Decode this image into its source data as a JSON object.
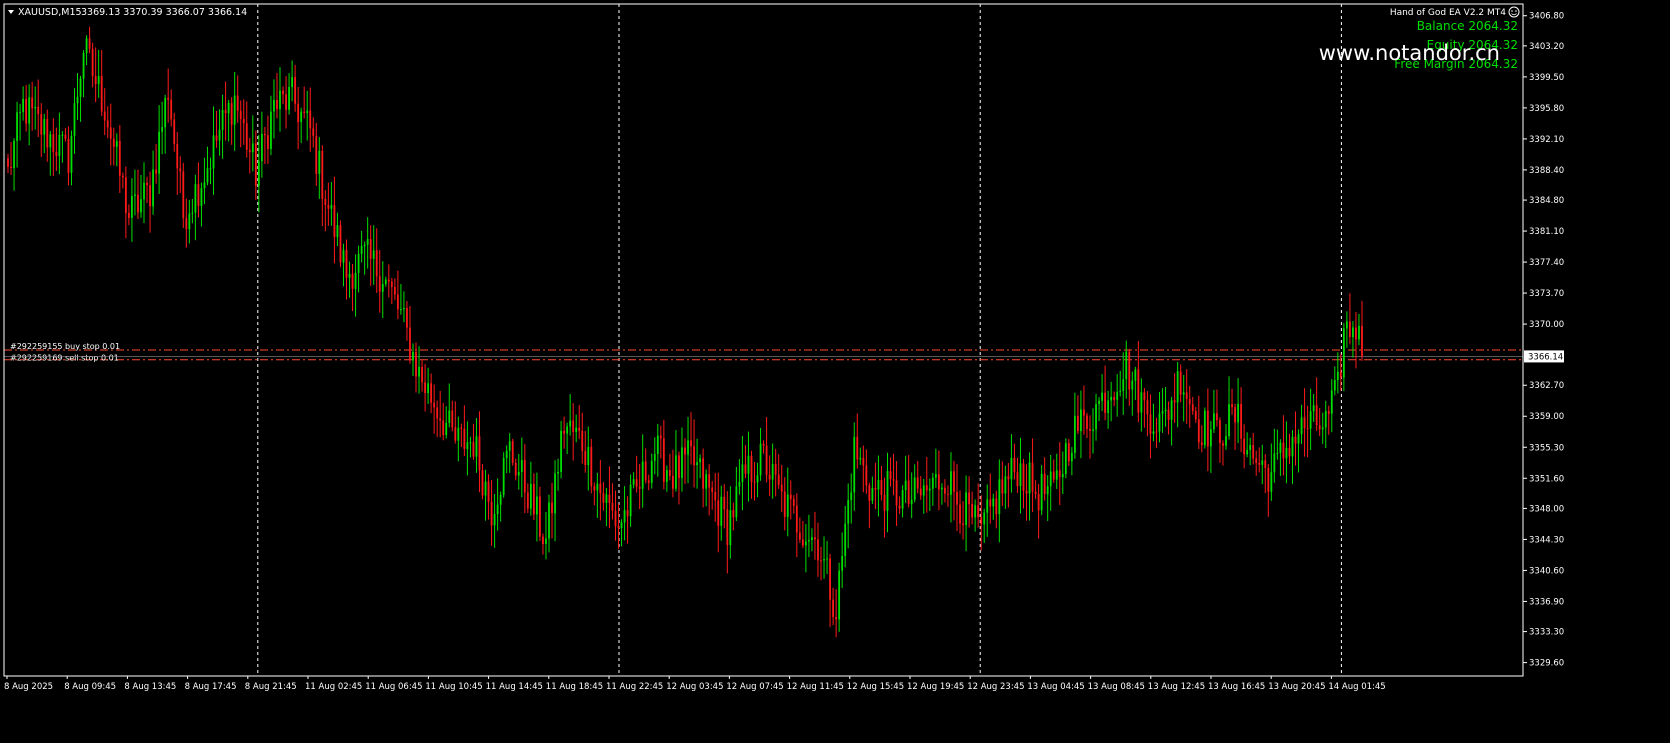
{
  "header": {
    "symbol": "XAUUSD,M15",
    "ohlc": "3369.13 3370.39 3366.07 3366.14"
  },
  "ea_panel": {
    "title": "Hand of God EA  V2.2 MT4",
    "balance": "Balance 2064.32",
    "equity": "Equity 2064.32",
    "free_margin": "Free Margin 2064.32",
    "watermark": "www.notandor.cn"
  },
  "orders": [
    {
      "label": "#292259155 buy stop 0.01",
      "price": 3366.9,
      "color": "#ff4d2e"
    },
    {
      "label": "#292259169 sell stop 0.01",
      "price": 3365.75,
      "color": "#ff4d2e"
    }
  ],
  "price_badge": {
    "value": "3366.14",
    "price": 3366.14
  },
  "colors": {
    "bull": "#00e000",
    "bear": "#ff1a1a",
    "grid": "#ffffff",
    "axis_text": "#ffffff",
    "background": "#000000"
  },
  "chart_data": {
    "type": "candlestick",
    "symbol": "XAUUSD",
    "timeframe": "M15",
    "ylim": [
      3328.0,
      3408.2
    ],
    "y_ticks": [
      "3406.80",
      "3403.20",
      "3399.50",
      "3395.80",
      "3392.10",
      "3388.40",
      "3384.80",
      "3381.10",
      "3377.40",
      "3373.70",
      "3370.00",
      "3366.14",
      "3362.70",
      "3359.00",
      "3355.30",
      "3351.60",
      "3348.00",
      "3344.30",
      "3340.60",
      "3336.90",
      "3333.30",
      "3329.60"
    ],
    "x_ticks": [
      "8 Aug 2025",
      "8 Aug 09:45",
      "8 Aug 13:45",
      "8 Aug 17:45",
      "8 Aug 21:45",
      "11 Aug 02:45",
      "11 Aug 06:45",
      "11 Aug 10:45",
      "11 Aug 14:45",
      "11 Aug 18:45",
      "11 Aug 22:45",
      "12 Aug 03:45",
      "12 Aug 07:45",
      "12 Aug 11:45",
      "12 Aug 15:45",
      "12 Aug 19:45",
      "12 Aug 23:45",
      "13 Aug 04:45",
      "13 Aug 08:45",
      "13 Aug 12:45",
      "13 Aug 16:45",
      "13 Aug 20:45",
      "14 Aug 01:45"
    ],
    "grid": "vertical dashed separators",
    "anchors": [
      [
        0,
        3388
      ],
      [
        5,
        3396
      ],
      [
        12,
        3393
      ],
      [
        20,
        3390
      ],
      [
        25,
        3403
      ],
      [
        32,
        3396
      ],
      [
        40,
        3383
      ],
      [
        47,
        3386
      ],
      [
        53,
        3398
      ],
      [
        58,
        3383
      ],
      [
        65,
        3388
      ],
      [
        70,
        3393
      ],
      [
        75,
        3397
      ],
      [
        82,
        3388
      ],
      [
        88,
        3396
      ],
      [
        94,
        3397
      ],
      [
        100,
        3393
      ],
      [
        106,
        3384
      ],
      [
        112,
        3376
      ],
      [
        118,
        3378
      ],
      [
        124,
        3376
      ],
      [
        130,
        3371
      ],
      [
        136,
        3364
      ],
      [
        142,
        3360
      ],
      [
        148,
        3356
      ],
      [
        154,
        3356
      ],
      [
        160,
        3348
      ],
      [
        166,
        3355
      ],
      [
        172,
        3350
      ],
      [
        178,
        3344
      ],
      [
        184,
        3358
      ],
      [
        190,
        3356
      ],
      [
        196,
        3350
      ],
      [
        202,
        3346
      ],
      [
        208,
        3350
      ],
      [
        214,
        3355
      ],
      [
        220,
        3352
      ],
      [
        226,
        3354
      ],
      [
        232,
        3350
      ],
      [
        238,
        3346
      ],
      [
        244,
        3352
      ],
      [
        250,
        3354
      ],
      [
        256,
        3349
      ],
      [
        262,
        3346
      ],
      [
        268,
        3344
      ],
      [
        274,
        3336
      ],
      [
        280,
        3355
      ],
      [
        286,
        3350
      ],
      [
        292,
        3350
      ],
      [
        298,
        3349
      ],
      [
        304,
        3350
      ],
      [
        310,
        3352
      ],
      [
        316,
        3348
      ],
      [
        322,
        3345
      ],
      [
        328,
        3350
      ],
      [
        334,
        3353
      ],
      [
        340,
        3350
      ],
      [
        346,
        3350
      ],
      [
        352,
        3357
      ],
      [
        358,
        3359
      ],
      [
        364,
        3362
      ],
      [
        370,
        3365
      ],
      [
        376,
        3360
      ],
      [
        382,
        3358
      ],
      [
        388,
        3364
      ],
      [
        394,
        3358
      ],
      [
        400,
        3357
      ],
      [
        406,
        3359
      ],
      [
        412,
        3354
      ],
      [
        418,
        3352
      ],
      [
        424,
        3356
      ],
      [
        430,
        3358
      ],
      [
        436,
        3358
      ],
      [
        440,
        3362
      ],
      [
        442,
        3369
      ],
      [
        446,
        3370
      ],
      [
        448,
        3366.14
      ]
    ]
  }
}
